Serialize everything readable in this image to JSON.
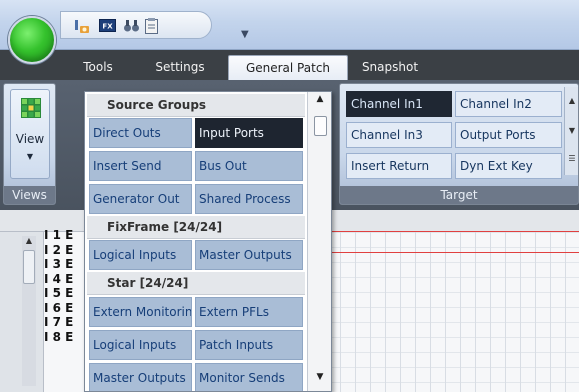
{
  "tabs": [
    "Tools",
    "Settings",
    "General Patch",
    "Snapshot"
  ],
  "views_group": {
    "button_label": "View",
    "group_label": "Views"
  },
  "target_group": {
    "group_label": "Target",
    "cells": [
      "Channel In1",
      "Channel In2",
      "Channel In3",
      "Output Ports",
      "Insert Return",
      "Dyn Ext Key"
    ],
    "selected": "Channel In1"
  },
  "dropdown": {
    "sections": [
      {
        "title": "Source Groups",
        "items": [
          "Direct Outs",
          "Input Ports",
          "Insert Send",
          "Bus Out",
          "Generator Out",
          "Shared Process"
        ],
        "selected": "Input Ports"
      },
      {
        "title": "FixFrame [24/24]",
        "items": [
          "Logical Inputs",
          "Master Outputs"
        ]
      },
      {
        "title": "Star [24/24]",
        "items": [
          "Extern Monitoring",
          "Extern PFLs",
          "Logical Inputs",
          "Patch Inputs",
          "Master Outputs",
          "Monitor Sends"
        ]
      }
    ]
  },
  "matrix": {
    "row_labels": [
      "I 1 E",
      "I 2 E",
      "I 3 E",
      "I 4 E",
      "I 5 E",
      "I 6 E",
      "I 7 E",
      "I 8 E"
    ]
  },
  "colors": {
    "selected": "#1e2530",
    "item": "#a9bdd6",
    "item_text": "#163e78",
    "tab_strip": "#3b4045",
    "orb": "#35c22d"
  }
}
